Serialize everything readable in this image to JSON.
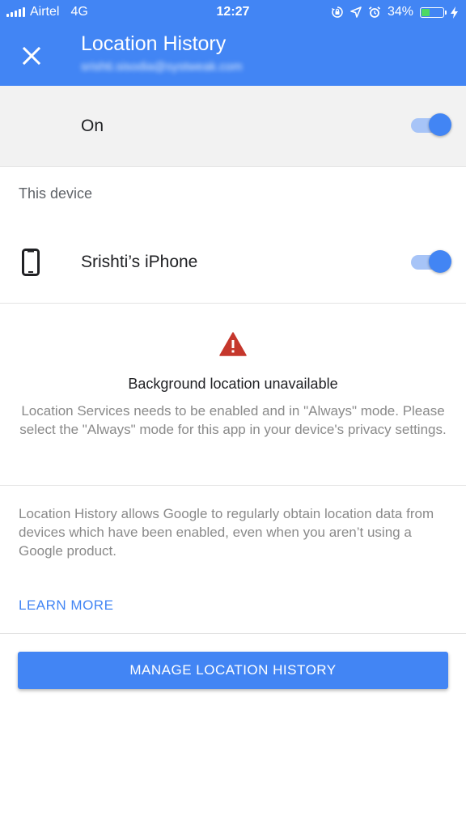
{
  "status_bar": {
    "carrier": "Airtel",
    "network": "4G",
    "time": "12:27",
    "battery_percent": "34%",
    "battery_level": 0.34,
    "icons": [
      "signal-icon",
      "orientation-lock-icon",
      "location-arrow-icon",
      "alarm-icon",
      "battery-icon",
      "charging-icon"
    ]
  },
  "app_bar": {
    "title": "Location History",
    "subtitle": "srishti.sisodia@systweak.com",
    "close_icon": "close-icon"
  },
  "master_toggle": {
    "label": "On",
    "state": "on"
  },
  "device_section": {
    "label": "This device",
    "device_name": "Srishti’s iPhone",
    "device_icon": "phone-icon",
    "toggle_state": "on"
  },
  "warning": {
    "icon": "warning-icon",
    "title": "Background location unavailable",
    "body": "Location Services needs to be enabled and in \"Always\" mode. Please select the \"Always\" mode for this app in your device's privacy settings."
  },
  "info": {
    "text": "Location History allows Google to regularly obtain location data from devices which have been enabled, even when you aren’t using a Google product.",
    "learn_more": "LEARN MORE"
  },
  "manage_button": {
    "label": "MANAGE LOCATION HISTORY"
  },
  "colors": {
    "accent": "#4285f4",
    "warning": "#c5372c",
    "toggle_track": "#a7c4f7"
  }
}
